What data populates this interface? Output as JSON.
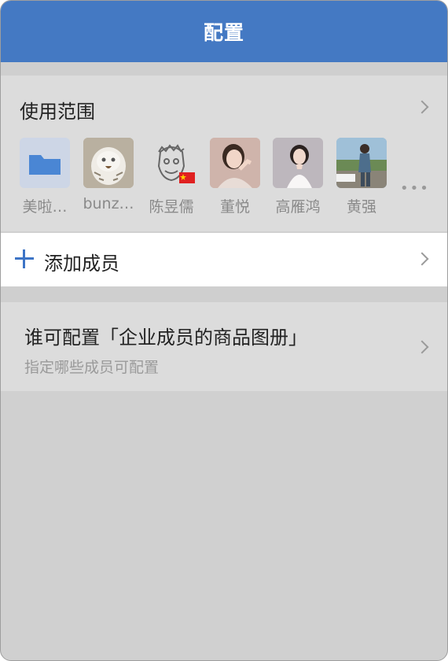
{
  "header": {
    "title": "配置"
  },
  "scope": {
    "title": "使用范围",
    "members": [
      {
        "name": "美啦…",
        "avatar_icon": "folder-icon"
      },
      {
        "name": "bunz…",
        "avatar_icon": "owl-photo"
      },
      {
        "name": "陈昱儒",
        "avatar_icon": "sketch-face-with-flag"
      },
      {
        "name": "董悦",
        "avatar_icon": "person-photo"
      },
      {
        "name": "高雁鸿",
        "avatar_icon": "person-photo"
      },
      {
        "name": "黄强",
        "avatar_icon": "person-photo"
      }
    ],
    "more": "•••"
  },
  "add_member": {
    "label": "添加成员"
  },
  "configurable": {
    "title": "谁可配置「企业成员的商品图册」",
    "subtitle": "指定哪些成员可配置"
  },
  "colors": {
    "accent": "#4479c3",
    "plus": "#3d74c6",
    "folder": "#4a86d4"
  }
}
